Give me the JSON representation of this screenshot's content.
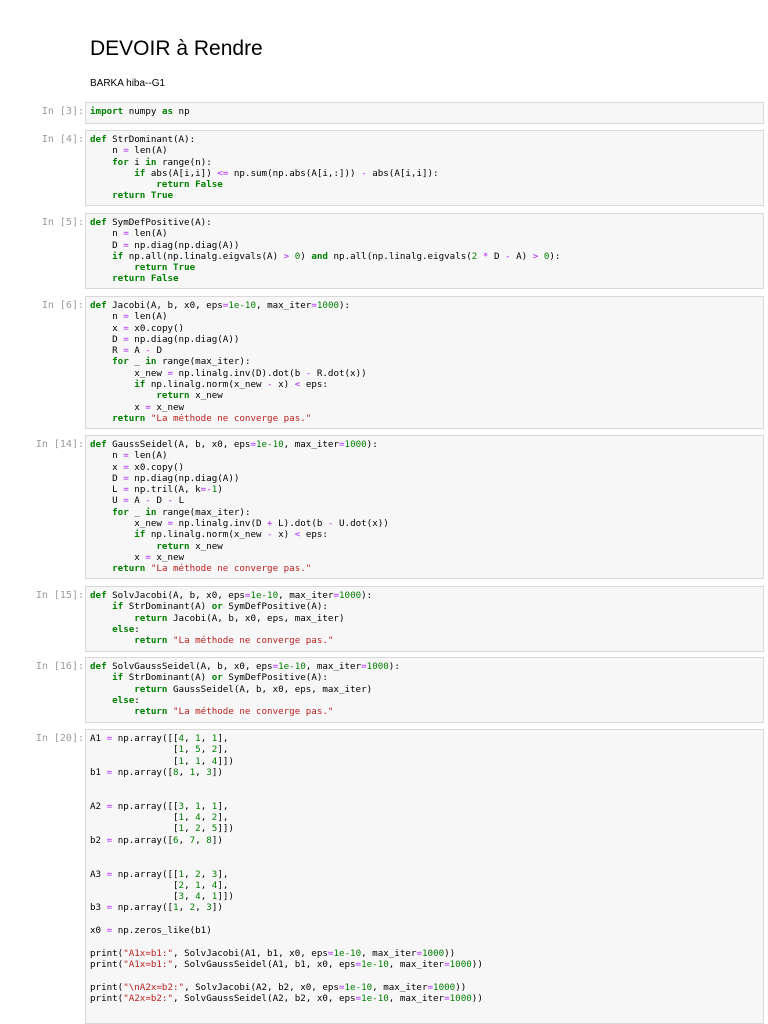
{
  "document": {
    "title": "DEVOIR à Rendre",
    "author": "BARKA hiba--G1"
  },
  "cells": [
    {
      "prompt": "In [3]:",
      "lines": [
        "import numpy as np"
      ]
    },
    {
      "prompt": "In [4]:",
      "lines": [
        "def StrDominant(A):",
        "    n = len(A)",
        "    for i in range(n):",
        "        if abs(A[i,i]) <= np.sum(np.abs(A[i,:])) - abs(A[i,i]):",
        "            return False",
        "    return True"
      ]
    },
    {
      "prompt": "In [5]:",
      "lines": [
        "def SymDefPositive(A):",
        "    n = len(A)",
        "    D = np.diag(np.diag(A))",
        "    if np.all(np.linalg.eigvals(A) > 0) and np.all(np.linalg.eigvals(2 * D - A) > 0):",
        "        return True",
        "    return False"
      ]
    },
    {
      "prompt": "In [6]:",
      "lines": [
        "def Jacobi(A, b, x0, eps=1e-10, max_iter=1000):",
        "    n = len(A)",
        "    x = x0.copy()",
        "    D = np.diag(np.diag(A))",
        "    R = A - D",
        "    for _ in range(max_iter):",
        "        x_new = np.linalg.inv(D).dot(b - R.dot(x))",
        "        if np.linalg.norm(x_new - x) < eps:",
        "            return x_new",
        "        x = x_new",
        "    return \"La méthode ne converge pas.\""
      ]
    },
    {
      "prompt": "In [14]:",
      "lines": [
        "def GaussSeidel(A, b, x0, eps=1e-10, max_iter=1000):",
        "    n = len(A)",
        "    x = x0.copy()",
        "    D = np.diag(np.diag(A))",
        "    L = np.tril(A, k=-1)",
        "    U = A - D - L",
        "    for _ in range(max_iter):",
        "        x_new = np.linalg.inv(D + L).dot(b - U.dot(x))",
        "        if np.linalg.norm(x_new - x) < eps:",
        "            return x_new",
        "        x = x_new",
        "    return \"La méthode ne converge pas.\""
      ]
    },
    {
      "prompt": "In [15]:",
      "lines": [
        "def SolvJacobi(A, b, x0, eps=1e-10, max_iter=1000):",
        "    if StrDominant(A) or SymDefPositive(A):",
        "        return Jacobi(A, b, x0, eps, max_iter)",
        "    else:",
        "        return \"La méthode ne converge pas.\""
      ]
    },
    {
      "prompt": "In [16]:",
      "lines": [
        "def SolvGaussSeidel(A, b, x0, eps=1e-10, max_iter=1000):",
        "    if StrDominant(A) or SymDefPositive(A):",
        "        return GaussSeidel(A, b, x0, eps, max_iter)",
        "    else:",
        "        return \"La méthode ne converge pas.\""
      ]
    },
    {
      "prompt": "In [20]:",
      "lines": [
        "A1 = np.array([[4, 1, 1],",
        "               [1, 5, 2],",
        "               [1, 1, 4]])",
        "b1 = np.array([8, 1, 3])",
        "",
        "",
        "A2 = np.array([[3, 1, 1],",
        "               [1, 4, 2],",
        "               [1, 2, 5]])",
        "b2 = np.array([6, 7, 8])",
        "",
        "",
        "A3 = np.array([[1, 2, 3],",
        "               [2, 1, 4],",
        "               [3, 4, 1]])",
        "b3 = np.array([1, 2, 3])",
        "",
        "x0 = np.zeros_like(b1)",
        "",
        "print(\"A1x=b1:\", SolvJacobi(A1, b1, x0, eps=1e-10, max_iter=1000))",
        "print(\"A1x=b1:\", SolvGaussSeidel(A1, b1, x0, eps=1e-10, max_iter=1000))",
        "",
        "print(\"\\nA2x=b2:\", SolvJacobi(A2, b2, x0, eps=1e-10, max_iter=1000))",
        "print(\"A2x=b2:\", SolvGaussSeidel(A2, b2, x0, eps=1e-10, max_iter=1000))"
      ]
    }
  ]
}
